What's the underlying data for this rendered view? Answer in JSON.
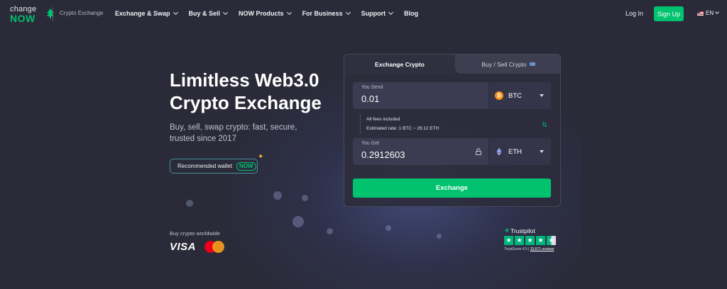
{
  "header": {
    "logo_top": "change",
    "logo_bottom": "NOW",
    "logo_sub": "Crypto Exchange",
    "nav": [
      {
        "label": "Exchange & Swap",
        "dropdown": true
      },
      {
        "label": "Buy & Sell",
        "dropdown": true
      },
      {
        "label": "NOW Products",
        "dropdown": true
      },
      {
        "label": "For Business",
        "dropdown": true
      },
      {
        "label": "Support",
        "dropdown": true
      },
      {
        "label": "Blog",
        "dropdown": false
      }
    ],
    "login": "Log In",
    "signup": "Sign Up",
    "language": "EN"
  },
  "hero": {
    "title_line1": "Limitless Web3.0",
    "title_line2": "Crypto Exchange",
    "subtitle": "Buy, sell, swap crypto: fast, secure, trusted since 2017",
    "wallet_pill": "Recommended wallet",
    "wallet_badge": "NOW",
    "buy_worldwide": "Buy crypto worldwide",
    "visa": "VISA"
  },
  "widget": {
    "tab_active": "Exchange Crypto",
    "tab_inactive": "Buy / Sell Crypto",
    "send_label": "You Send",
    "send_value": "0.01",
    "send_coin": "BTC",
    "get_label": "You Get",
    "get_value": "0.2912603",
    "get_coin": "ETH",
    "fees_text": "All fees included",
    "rate_text": "Estimated rate: 1 BTC ~ 29.12 ETH",
    "exchange_button": "Exchange"
  },
  "trustpilot": {
    "name": "Trustpilot",
    "score_text": "TrustScore 4.5",
    "separator": "|",
    "reviews": "33,671 reviews"
  },
  "colors": {
    "accent": "#00c26f",
    "background": "#2a2a38",
    "btc": "#f7931a",
    "trustpilot": "#00b67a"
  }
}
